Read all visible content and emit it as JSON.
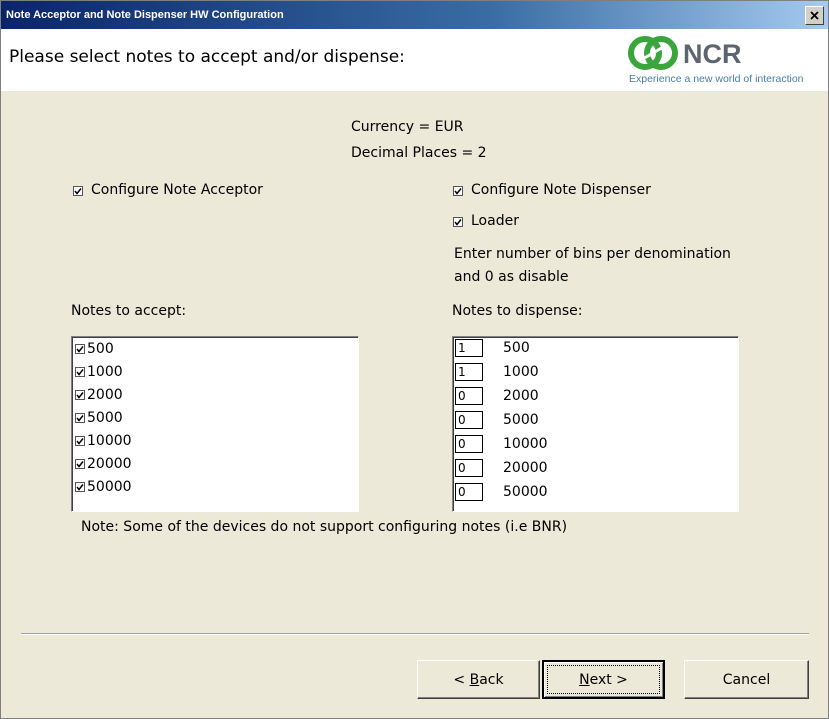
{
  "window": {
    "title": "Note Acceptor and Note Dispenser HW Configuration"
  },
  "header": {
    "prompt": "Please select notes to accept and/or dispense:",
    "logo_word": "NCR",
    "logo_tagline": "Experience a new world of interaction"
  },
  "info": {
    "currency": "Currency = EUR",
    "decimal_places": "Decimal Places = 2"
  },
  "options": {
    "configure_acceptor": {
      "label": "Configure Note Acceptor",
      "checked": true
    },
    "configure_dispenser": {
      "label": "Configure Note Dispenser",
      "checked": true
    },
    "loader": {
      "label": "Loader",
      "checked": true
    }
  },
  "instructions": {
    "line1": "Enter number of bins per denomination",
    "line2": "and 0 as disable"
  },
  "accept": {
    "label": "Notes to accept:",
    "items": [
      {
        "value": "500",
        "checked": true
      },
      {
        "value": "1000",
        "checked": true
      },
      {
        "value": "2000",
        "checked": true
      },
      {
        "value": "5000",
        "checked": true
      },
      {
        "value": "10000",
        "checked": true
      },
      {
        "value": "20000",
        "checked": true
      },
      {
        "value": "50000",
        "checked": true
      }
    ]
  },
  "dispense": {
    "label": "Notes to dispense:",
    "items": [
      {
        "bins": "1",
        "value": "500"
      },
      {
        "bins": "1",
        "value": "1000"
      },
      {
        "bins": "0",
        "value": "2000"
      },
      {
        "bins": "0",
        "value": "5000"
      },
      {
        "bins": "0",
        "value": "10000"
      },
      {
        "bins": "0",
        "value": "20000"
      },
      {
        "bins": "0",
        "value": "50000"
      }
    ]
  },
  "note": "Note: Some of the devices do not support configuring notes (i.e BNR)",
  "buttons": {
    "back": {
      "prefix": "< ",
      "accel": "B",
      "rest": "ack"
    },
    "next": {
      "accel": "N",
      "rest": "ext >"
    },
    "cancel": "Cancel"
  },
  "colors": {
    "titlebar_start": "#0a246a",
    "logo_green": "#3aa53a",
    "logo_gray": "#5d6570",
    "tagline_blue": "#4a7ea8"
  }
}
